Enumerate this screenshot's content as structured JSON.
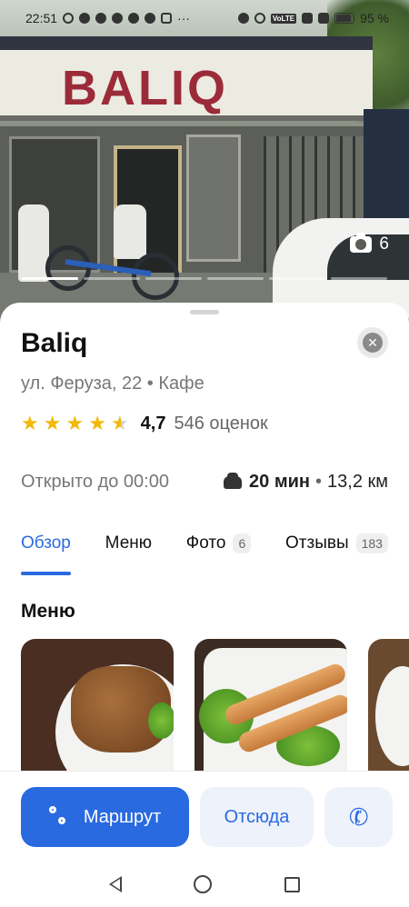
{
  "status_bar": {
    "time": "22:51",
    "dots": "···",
    "network_badge": "VoLTE",
    "battery": "95 %",
    "icons": [
      "eye-icon",
      "alarm-icon",
      "telegram-icon",
      "telegram-icon",
      "telegram-icon",
      "chat-icon",
      "instagram-icon",
      "location-icon",
      "wifi-icon",
      "signal-icon",
      "battery-icon"
    ]
  },
  "photo": {
    "sign_text": "BALIQ",
    "photo_count": "6",
    "progress_segments": 6,
    "active_segment": 1
  },
  "place": {
    "name": "Baliq",
    "address": "ул. Феруза, 22",
    "separator": "•",
    "category": "Кафе",
    "rating": "4,7",
    "rating_stars": 4.7,
    "reviews_count": "546 оценок",
    "hours": "Открыто до 00:00",
    "commute_time": "20 мин",
    "commute_distance": "13,2 км"
  },
  "tabs": [
    {
      "label": "Обзор",
      "badge": ""
    },
    {
      "label": "Меню",
      "badge": ""
    },
    {
      "label": "Фото",
      "badge": "6"
    },
    {
      "label": "Отзывы",
      "badge": "183"
    }
  ],
  "menu_section": {
    "heading": "Меню"
  },
  "actions": {
    "route_label": "Маршрут",
    "from_here_label": "Отсюда"
  },
  "colors": {
    "accent": "#2a6ae0",
    "star": "#f2b90c",
    "sign": "#9c2b3a"
  }
}
